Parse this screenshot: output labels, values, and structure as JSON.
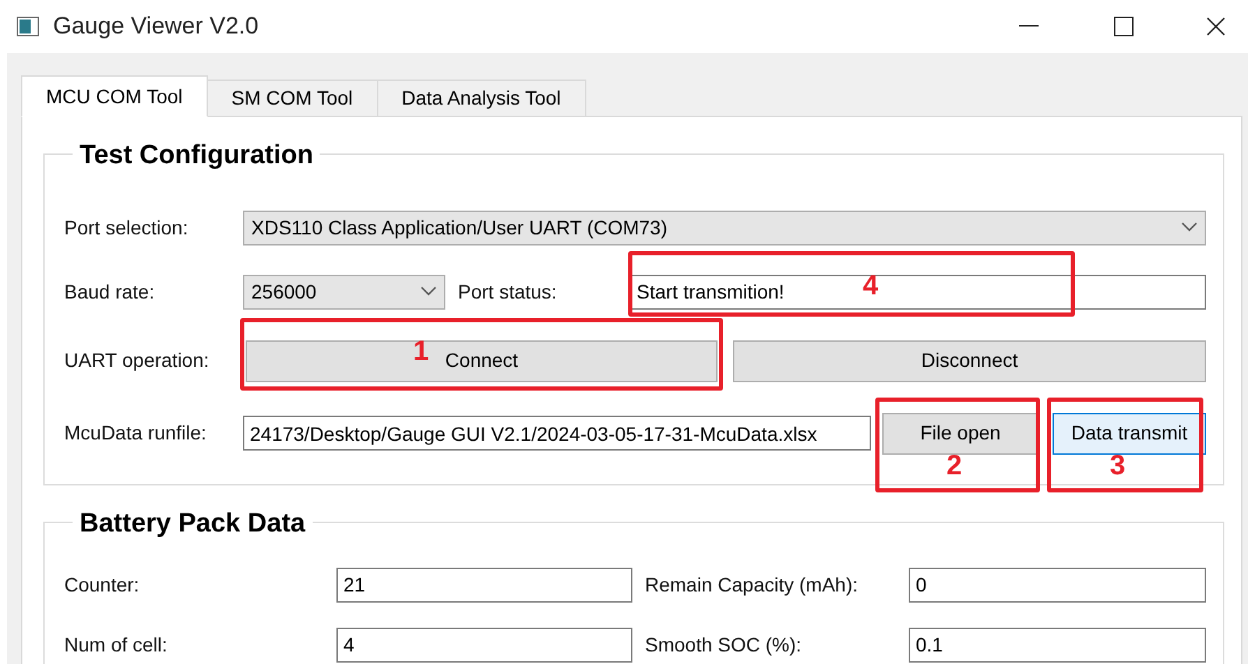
{
  "window": {
    "title": "Gauge Viewer V2.0"
  },
  "tabs": [
    {
      "label": "MCU COM Tool",
      "selected": true
    },
    {
      "label": "SM COM Tool",
      "selected": false
    },
    {
      "label": "Data Analysis Tool",
      "selected": false
    }
  ],
  "test_configuration": {
    "title": "Test Configuration",
    "port_selection": {
      "label": "Port selection:",
      "value": "XDS110 Class Application/User UART (COM73)"
    },
    "baud_rate": {
      "label": "Baud rate:",
      "value": "256000"
    },
    "port_status": {
      "label": "Port status:",
      "value": "Start transmition!"
    },
    "uart_operation": {
      "label": "UART operation:",
      "buttons": [
        {
          "label": "Connect",
          "focused": false
        },
        {
          "label": "Disconnect",
          "focused": false
        }
      ]
    },
    "runfile": {
      "label": "McuData runfile:",
      "value": "24173/Desktop/Gauge GUI V2.1/2024-03-05-17-31-McuData.xlsx",
      "buttons": [
        {
          "label": "File open",
          "focused": false
        },
        {
          "label": "Data transmit",
          "focused": true
        }
      ]
    }
  },
  "battery_pack_data": {
    "title": "Battery Pack Data",
    "rows": [
      {
        "label": "Counter:",
        "value": "21",
        "label_2": "Remain Capacity (mAh):",
        "value_2": "0"
      },
      {
        "label": "Num of cell:",
        "value": "4",
        "label_2": "Smooth SOC (%):",
        "value_2": "0.1"
      }
    ]
  },
  "annotations": [
    "1",
    "2",
    "3",
    "4"
  ]
}
